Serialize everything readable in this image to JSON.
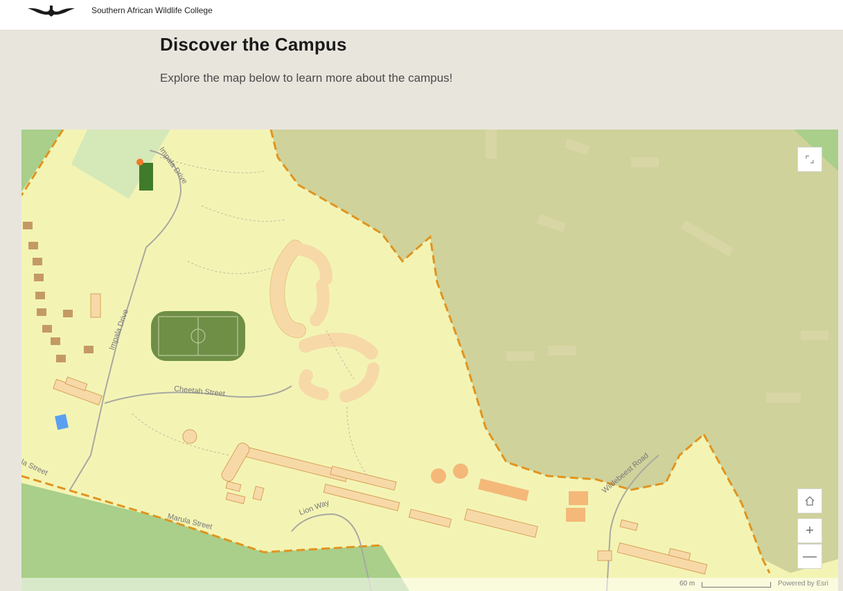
{
  "header": {
    "org_name": "Southern African Wildlife College",
    "logo_icon": "wildlife-logo-icon"
  },
  "main": {
    "title": "Discover the Campus",
    "subtitle": "Explore the map below to learn more about the campus!"
  },
  "map": {
    "labels": {
      "impala_drive_top": "Impala Drive",
      "impala_drive_left": "Impala Drive",
      "cheetah_street": "Cheetah Street",
      "marula_street": "Marula Street",
      "lion_way": "Lion Way",
      "wildebeest_road": "Wildebeest Road",
      "la_street": "la Street"
    },
    "controls": {
      "expand_icon": "expand-icon",
      "home_icon": "home-icon",
      "zoom_in": "+",
      "zoom_out": "—"
    },
    "scale": "60 m",
    "attribution": "Powered by Esri",
    "colors": {
      "campus_fill": "#f3f4b4",
      "bush_fill": "#cfd29a",
      "forest_fill": "#a9cf8a",
      "field_green": "#6f8f47",
      "building_fill": "#f7d9a8",
      "building_stroke": "#d9a058",
      "boundary": "#e0941f"
    }
  }
}
